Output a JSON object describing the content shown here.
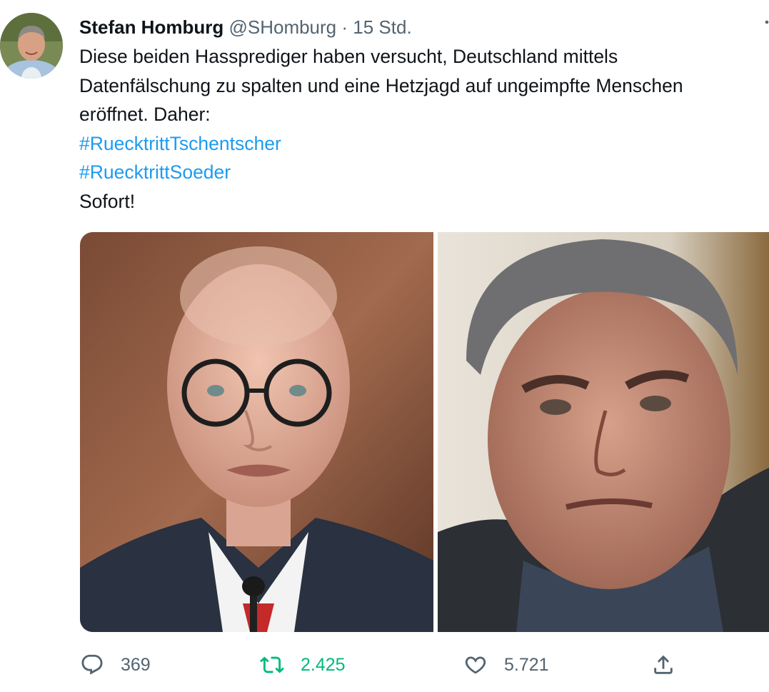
{
  "tweet": {
    "author": {
      "display_name": "Stefan Homburg",
      "handle": "@SHomburg",
      "separator": "·",
      "time": "15 Std."
    },
    "text_lines": [
      "Diese beiden Hassprediger haben versucht, Deutschland mittels",
      "Datenfälschung zu spalten und eine Hetzjagd auf ungeimpfte Menschen",
      "eröffnet. Daher:"
    ],
    "hashtags": [
      "#RuecktrittTschentscher",
      "#RuecktrittSoeder"
    ],
    "closing": "Sofort!",
    "media": [
      {
        "kind": "photo",
        "subject": "bald man with round glasses, dark suit, red tie, microphone"
      },
      {
        "kind": "photo",
        "subject": "man with gray hair, frowning, dark scarf"
      }
    ],
    "actions": {
      "replies": "369",
      "retweets": "2.425",
      "likes": "5.721"
    },
    "icons": [
      "reply-icon",
      "retweet-icon",
      "like-icon",
      "share-icon",
      "more-icon"
    ],
    "colors": {
      "text": "#0f1419",
      "secondary": "#536471",
      "hashtag": "#1d9bf0",
      "retweet_active": "#00ba7c"
    }
  }
}
